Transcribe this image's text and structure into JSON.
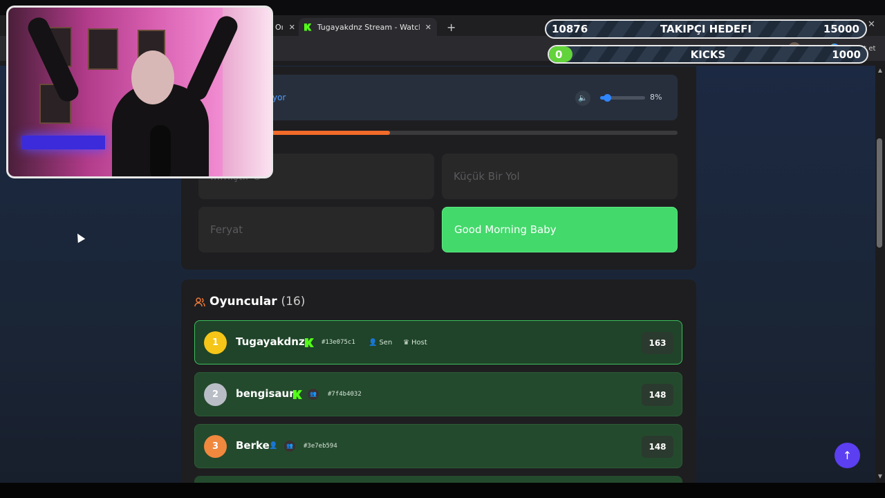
{
  "browser": {
    "tabs": [
      {
        "label": "Oı",
        "active": false
      },
      {
        "label": "Tugayakdnz Stream - Watch Live o",
        "active": true
      }
    ],
    "chat_label": "Sohbet et"
  },
  "overlay": {
    "follow_goal": {
      "current": "10876",
      "label": "TAKIPÇI HEDEFI",
      "target": "15000"
    },
    "kicks_goal": {
      "current": "0",
      "label": "KICKS",
      "target": "1000",
      "progress": 0.05
    }
  },
  "game": {
    "now_playing_text": "yor",
    "volume": {
      "percent_label": "8%",
      "value": 0.08
    },
    "progress": 0.4,
    "answers": [
      {
        "label": "...mıştır O",
        "state": "faded"
      },
      {
        "label": "Küçük Bir Yol",
        "state": "faded"
      },
      {
        "label": "Feryat",
        "state": "faded"
      },
      {
        "label": "Good Morning Baby",
        "state": "correct"
      }
    ]
  },
  "players": {
    "title": "Oyuncular",
    "count": "(16)",
    "list": [
      {
        "rank": "1",
        "name": "Tugayakdnz",
        "id": "#13e075c1",
        "you_label": "Sen",
        "host_label": "Host",
        "score": "163",
        "rank_color": "#f5c518"
      },
      {
        "rank": "2",
        "name": "bengisaur",
        "id": "#7f4b4032",
        "score": "148",
        "rank_color": "#b9bec6"
      },
      {
        "rank": "3",
        "name": "Berke",
        "id": "#3e7eb594",
        "score": "148",
        "rank_color": "#f0883e"
      }
    ]
  },
  "colors": {
    "accent_orange": "#f26b2a",
    "correct_green": "#43d96b",
    "kick_green": "#53fc18",
    "fab_purple": "#5b3ff0"
  }
}
